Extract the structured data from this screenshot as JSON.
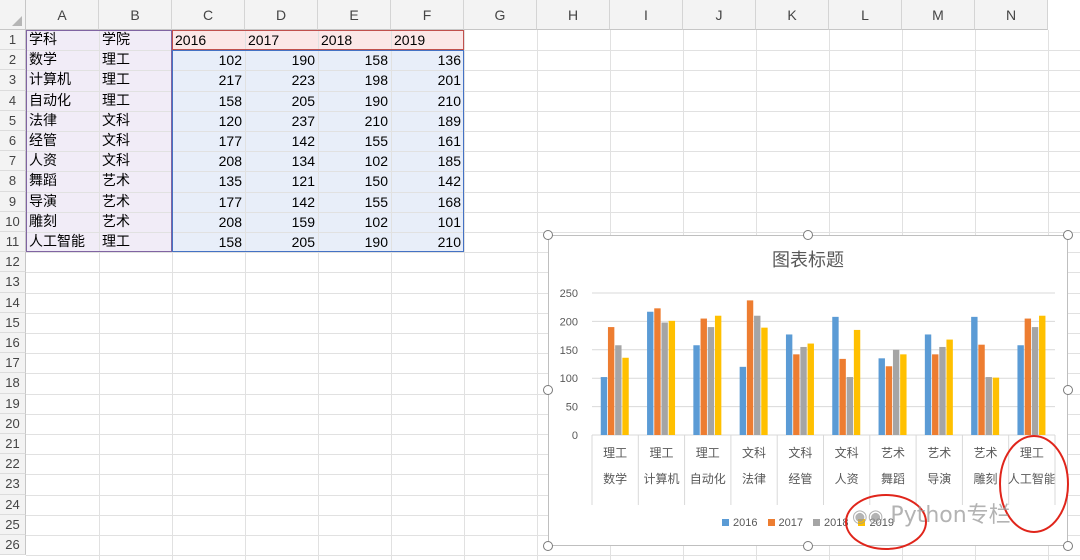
{
  "columns": [
    "A",
    "B",
    "C",
    "D",
    "E",
    "F",
    "G",
    "H",
    "I",
    "J",
    "K",
    "L",
    "M",
    "N"
  ],
  "rows": [
    "1",
    "2",
    "3",
    "4",
    "5",
    "6",
    "7",
    "8",
    "9",
    "10",
    "11",
    "12",
    "13",
    "14",
    "15",
    "16",
    "17",
    "18",
    "19",
    "20",
    "21",
    "22",
    "23",
    "24",
    "25",
    "26"
  ],
  "sheet": {
    "header": [
      "学科",
      "学院",
      "2016",
      "2017",
      "2018",
      "2019"
    ],
    "data": [
      [
        "数学",
        "理工",
        "102",
        "190",
        "158",
        "136"
      ],
      [
        "计算机",
        "理工",
        "217",
        "223",
        "198",
        "201"
      ],
      [
        "自动化",
        "理工",
        "158",
        "205",
        "190",
        "210"
      ],
      [
        "法律",
        "文科",
        "120",
        "237",
        "210",
        "189"
      ],
      [
        "经管",
        "文科",
        "177",
        "142",
        "155",
        "161"
      ],
      [
        "人资",
        "文科",
        "208",
        "134",
        "102",
        "185"
      ],
      [
        "舞蹈",
        "艺术",
        "135",
        "121",
        "150",
        "142"
      ],
      [
        "导演",
        "艺术",
        "177",
        "142",
        "155",
        "168"
      ],
      [
        "雕刻",
        "艺术",
        "208",
        "159",
        "102",
        "101"
      ],
      [
        "人工智能",
        "理工",
        "158",
        "205",
        "190",
        "210"
      ]
    ]
  },
  "chart_data": {
    "type": "bar",
    "title": "图表标题",
    "categories": [
      {
        "group": "理工",
        "name": "数学"
      },
      {
        "group": "理工",
        "name": "计算机"
      },
      {
        "group": "理工",
        "name": "自动化"
      },
      {
        "group": "文科",
        "name": "法律"
      },
      {
        "group": "文科",
        "name": "经管"
      },
      {
        "group": "文科",
        "name": "人资"
      },
      {
        "group": "艺术",
        "name": "舞蹈"
      },
      {
        "group": "艺术",
        "name": "导演"
      },
      {
        "group": "艺术",
        "name": "雕刻"
      },
      {
        "group": "理工",
        "name": "人工智能"
      }
    ],
    "series": [
      {
        "name": "2016",
        "color": "#5b9bd5",
        "values": [
          102,
          217,
          158,
          120,
          177,
          208,
          135,
          177,
          208,
          158
        ]
      },
      {
        "name": "2017",
        "color": "#ed7d31",
        "values": [
          190,
          223,
          205,
          237,
          142,
          134,
          121,
          142,
          159,
          205
        ]
      },
      {
        "name": "2018",
        "color": "#a5a5a5",
        "values": [
          158,
          198,
          190,
          210,
          155,
          102,
          150,
          155,
          102,
          190
        ]
      },
      {
        "name": "2019",
        "color": "#ffc000",
        "values": [
          136,
          201,
          210,
          189,
          161,
          185,
          142,
          168,
          101,
          210
        ]
      }
    ],
    "yticks": [
      0,
      50,
      100,
      150,
      200,
      250
    ],
    "ylim": [
      0,
      250
    ],
    "grid": true,
    "legend": "bottom"
  },
  "watermark": "Python专栏",
  "colors": {
    "annotation_circle": "#e0251b",
    "range_blue": "#4472c4",
    "range_red": "#c0504d",
    "range_purple": "#8064a2"
  }
}
